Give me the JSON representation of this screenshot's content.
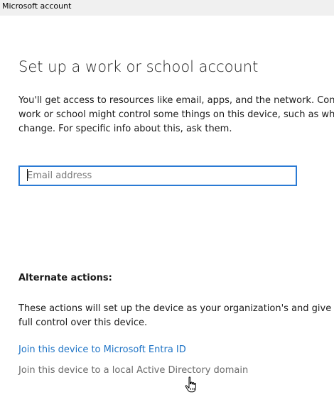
{
  "window": {
    "title": "Microsoft account"
  },
  "main": {
    "heading": "Set up a work or school account",
    "intro_lines": [
      "You'll get access to resources like email, apps, and the network. Con",
      "work or school might control some things on this device, such as wh",
      "change. For specific info about this, ask them."
    ],
    "email": {
      "placeholder": "Email address",
      "value": ""
    }
  },
  "alternate": {
    "heading": "Alternate actions:",
    "description_lines": [
      "These actions will set up the device as your organization's and give y",
      "full control over this device."
    ],
    "link_entra": "Join this device to Microsoft Entra ID",
    "link_ad": "Join this device to a local Active Directory domain"
  },
  "icons": {
    "pointer": "hand-pointer-icon"
  },
  "colors": {
    "accent": "#2a7ad4",
    "link": "#1f74c6",
    "disabled_link": "#6b6b6b"
  }
}
